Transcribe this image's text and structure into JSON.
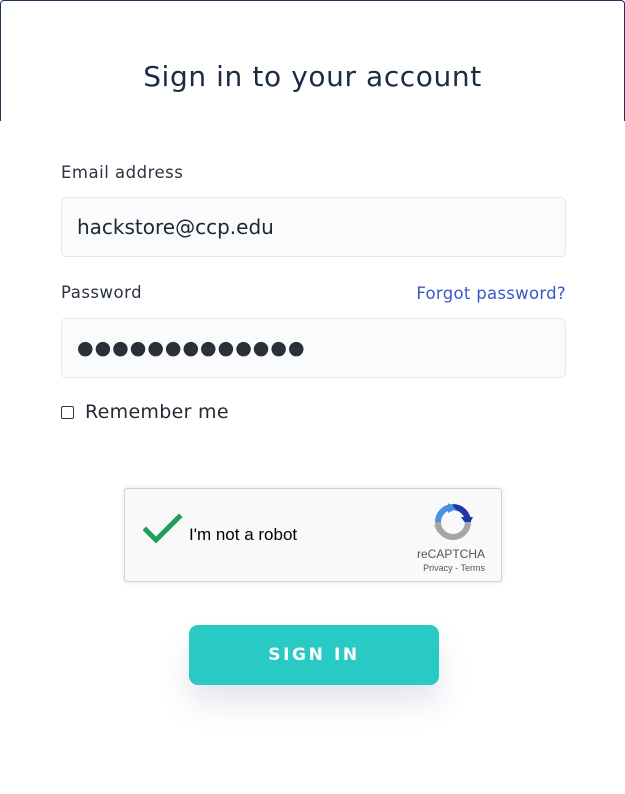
{
  "form": {
    "title": "Sign in to your account",
    "email_label": "Email address",
    "email_value": "hackstore@ccp.edu",
    "password_label": "Password",
    "forgot_link": "Forgot password?",
    "password_masked": "●●●●●●●●●●●●●",
    "remember_label": "Remember me",
    "remember_checked": false,
    "submit_label": "SIGN IN"
  },
  "recaptcha": {
    "label": "I'm not a robot",
    "checked": true,
    "brand": "reCAPTCHA",
    "privacy": "Privacy",
    "separator": " - ",
    "terms": "Terms"
  },
  "colors": {
    "accent": "#29c9c4",
    "link": "#3b57c7",
    "title": "#1c2b44",
    "check_green": "#1e9e5a"
  }
}
